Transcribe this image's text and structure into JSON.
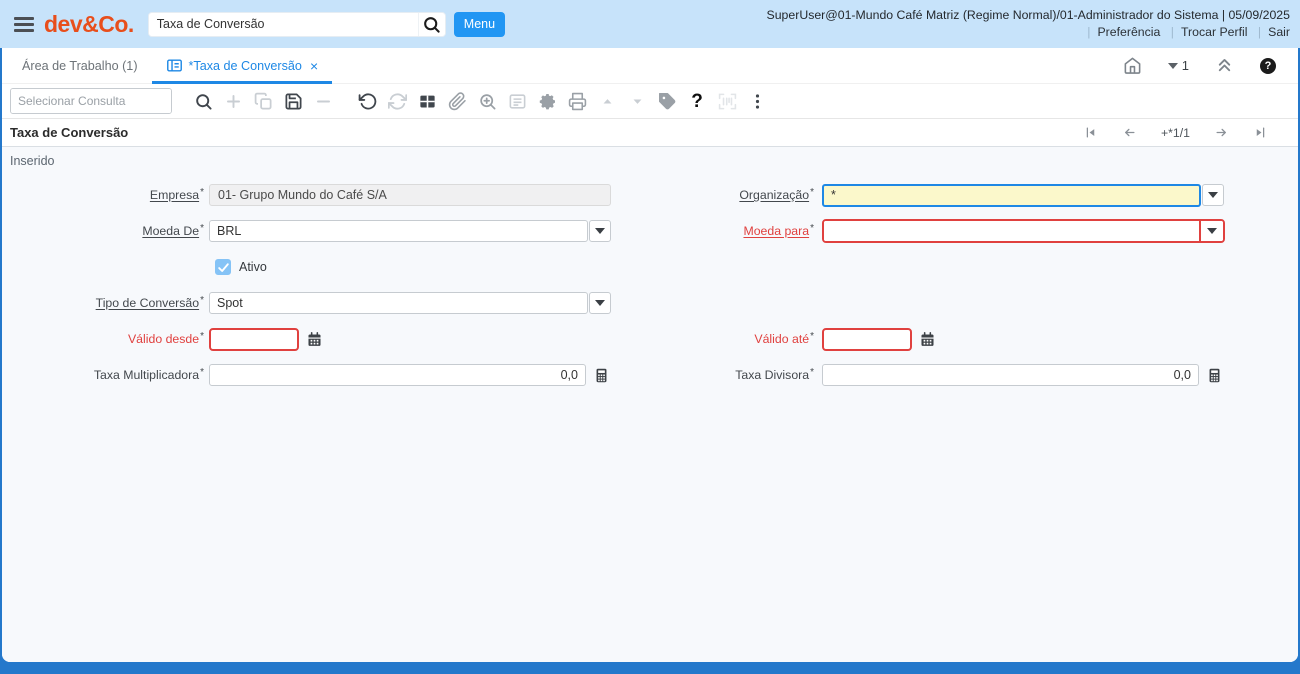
{
  "topbar": {
    "logo": "dev&Co.",
    "search": {
      "value": "Taxa de Conversão"
    },
    "menu_label": "Menu",
    "session_info": "SuperUser@01-Mundo Café Matriz (Regime Normal)/01-Administrador do Sistema | 05/09/2025",
    "separator": "|",
    "links": {
      "preferences": "Preferência",
      "switch_profile": "Trocar Perfil",
      "logout": "Sair"
    }
  },
  "tabbar": {
    "workspace_tab": "Área de Trabalho (1)",
    "active_tab": "*Taxa de Conversão",
    "close_glyph": "×",
    "nav_count": "1",
    "help_glyph": "?"
  },
  "toolbar": {
    "select_query_placeholder": "Selecionar Consulta",
    "help_glyph": "?"
  },
  "record": {
    "title": "Taxa de Conversão",
    "pagination": "+*1/1",
    "status": "Inserido"
  },
  "form": {
    "required_marker": "*",
    "empresa": {
      "label": "Empresa",
      "value": "01- Grupo Mundo do Café S/A"
    },
    "organizacao": {
      "label": "Organização",
      "value": "*"
    },
    "moeda_de": {
      "label": "Moeda De",
      "value": "BRL"
    },
    "moeda_para": {
      "label": "Moeda para",
      "value": ""
    },
    "ativo": {
      "label": "Ativo",
      "checked": true
    },
    "tipo_conversao": {
      "label": "Tipo de Conversão",
      "value": "Spot"
    },
    "valido_desde": {
      "label": "Válido desde",
      "value": ""
    },
    "valido_ate": {
      "label": "Válido até",
      "value": ""
    },
    "taxa_multiplicadora": {
      "label": "Taxa Multiplicadora",
      "value": "0,0"
    },
    "taxa_divisora": {
      "label": "Taxa Divisora",
      "value": "0,0"
    }
  },
  "colors": {
    "accent_blue": "#1e88e5",
    "page_blue": "#2478cb",
    "topbar_blue": "#c7e3fa",
    "logo_orange": "#e84e1b",
    "error_red": "#e0413f",
    "required_yellow": "#fbf8cb"
  }
}
